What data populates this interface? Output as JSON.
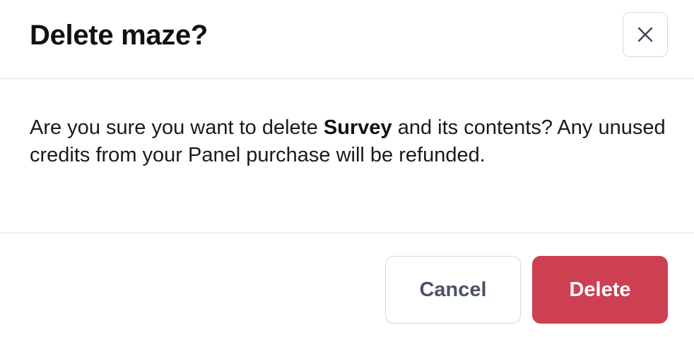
{
  "dialog": {
    "title": "Delete maze?",
    "close_icon": "close-icon",
    "message": {
      "before": "Are you sure you want to delete ",
      "item_name": "Survey",
      "after": " and its contents?  Any unused credits from your Panel purchase will be refunded."
    },
    "actions": {
      "cancel_label": "Cancel",
      "delete_label": "Delete"
    }
  },
  "colors": {
    "danger": "#cd4052",
    "cancel_text": "#4b5168",
    "border": "#d6d7dd",
    "divider": "#e3e3e6"
  }
}
